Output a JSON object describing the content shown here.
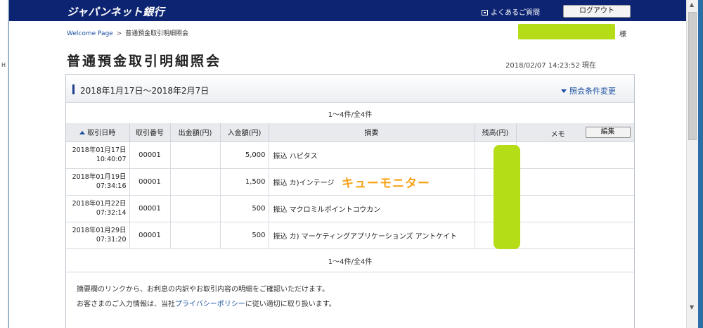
{
  "header": {
    "logo": "ジャパンネット銀行",
    "faq": "よくあるご質問",
    "logout": "ログアウト"
  },
  "breadcrumb": {
    "home": "Welcome Page",
    "separator": ">",
    "current": "普通預金取引明細照会"
  },
  "user": {
    "suffix": "様"
  },
  "page": {
    "title": "普通預金取引明細照会",
    "datetime": "2018/02/07 14:23:52 現在"
  },
  "panel": {
    "period": "2018年1月17日〜2018年2月7日",
    "change_link": "照会条件変更",
    "count_top": "1〜4件/全4件",
    "count_bottom": "1〜4件/全4件"
  },
  "table": {
    "headers": {
      "date": "取引日時",
      "number": "取引番号",
      "withdrawal": "出金額(円)",
      "deposit": "入金額(円)",
      "description": "摘要",
      "balance": "残高(円)",
      "memo": "メモ",
      "edit": "編集"
    },
    "rows": [
      {
        "date": "2018年01月17日",
        "time": "10:40:07",
        "number": "00001",
        "withdrawal": "",
        "deposit": "5,000",
        "description": "振込 ハピタス",
        "memo": ""
      },
      {
        "date": "2018年01月19日",
        "time": "07:34:16",
        "number": "00001",
        "withdrawal": "",
        "deposit": "1,500",
        "description": "振込 カ)インテージ",
        "memo": ""
      },
      {
        "date": "2018年01月22日",
        "time": "07:32:14",
        "number": "00001",
        "withdrawal": "",
        "deposit": "500",
        "description": "振込 マクロミルポイントコウカン",
        "memo": ""
      },
      {
        "date": "2018年01月29日",
        "time": "07:31:20",
        "number": "00001",
        "withdrawal": "",
        "deposit": "500",
        "description": "振込 カ) マーケティングアプリケーションズ アントケイト",
        "memo": ""
      }
    ]
  },
  "overlay_text": "キューモニター",
  "notes": {
    "line1": "摘要欄のリンクから、お利息の内訳やお取引内容の明細をご確認いただけます。",
    "line2_before": "お客さまのご入力情報は、当社",
    "line2_link": "プライバシーポリシー",
    "line2_after": "に従い適切に取り扱います。"
  },
  "colors": {
    "header_bg": "#0d2472",
    "link": "#1a4fa0",
    "mask": "#b5dd17",
    "overlay_text": "#f7a31a"
  }
}
